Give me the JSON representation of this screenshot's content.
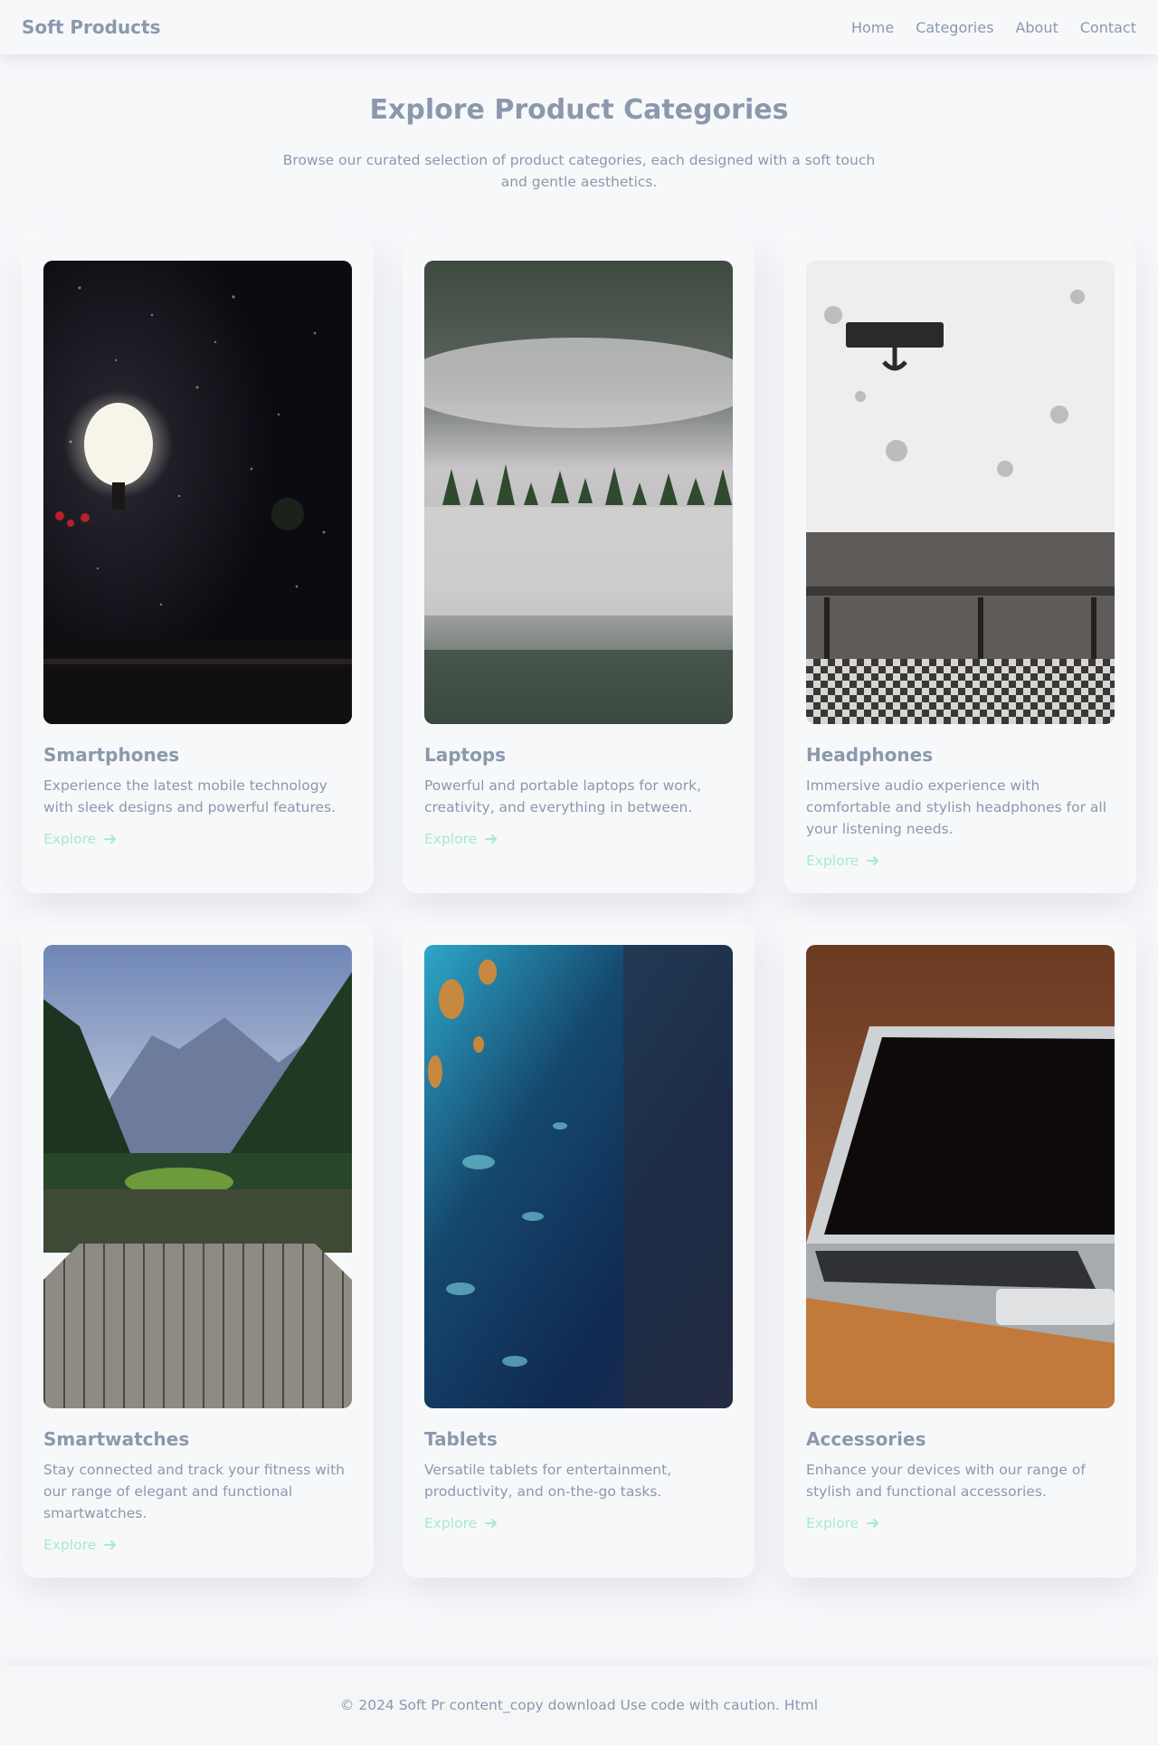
{
  "nav": {
    "brand": "Soft Products",
    "links": [
      "Home",
      "Categories",
      "About",
      "Contact"
    ]
  },
  "hero": {
    "title": "Explore Product Categories",
    "subtitle": "Browse our curated selection of product categories, each designed with a soft touch and gentle aesthetics."
  },
  "cards": [
    {
      "title": "Smartphones",
      "description": "Experience the latest mobile technology with sleek designs and powerful features.",
      "link": "Explore",
      "image": "night-streetlamp-rain-photo"
    },
    {
      "title": "Laptops",
      "description": "Powerful and portable laptops for work, creativity, and everything in between.",
      "link": "Explore",
      "image": "misty-forest-lake-photo"
    },
    {
      "title": "Headphones",
      "description": "Immersive audio experience with comfortable and stylish headphones for all your listening needs.",
      "link": "Explore",
      "image": "bench-against-wall-photo"
    },
    {
      "title": "Smartwatches",
      "description": "Stay connected and track your fitness with our range of elegant and functional smartwatches.",
      "link": "Explore",
      "image": "mountain-lake-dock-photo"
    },
    {
      "title": "Tablets",
      "description": "Versatile tablets for entertainment, productivity, and on-the-go tasks.",
      "link": "Explore",
      "image": "ocean-aerial-photo"
    },
    {
      "title": "Accessories",
      "description": "Enhance your devices with our range of stylish and functional accessories.",
      "link": "Explore",
      "image": "laptop-on-desk-photo"
    }
  ],
  "footer": {
    "text": "© 2024 Soft Pr content_copy download Use code with caution. Html"
  },
  "colors": {
    "background": "#f7f8fa",
    "text": "#8b98ad",
    "accent": "#a6ead1"
  }
}
